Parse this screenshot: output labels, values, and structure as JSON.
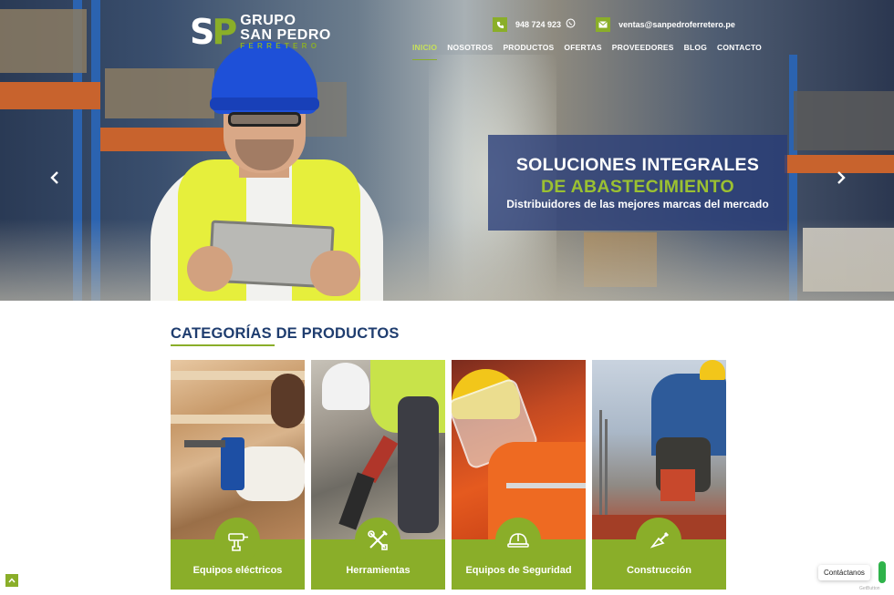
{
  "logo": {
    "mark_s": "S",
    "mark_p": "P",
    "line1": "GRUPO",
    "line2": "SAN PEDRO",
    "line3": "FERRETERO"
  },
  "contact": {
    "phone": "948 724 923",
    "email": "ventas@sanpedroferretero.pe"
  },
  "nav": {
    "items": [
      "INICIO",
      "NOSOTROS",
      "PRODUCTOS",
      "OFERTAS",
      "PROVEEDORES",
      "BLOG",
      "CONTACTO"
    ],
    "active": "INICIO"
  },
  "slider": {
    "prev_arrow": "‹",
    "next_arrow": "›"
  },
  "banner": {
    "line1": "SOLUCIONES INTEGRALES",
    "line2": "DE ABASTECIMIENTO",
    "line3": "Distribuidores de las mejores marcas del mercado"
  },
  "categories": {
    "title": "CATEGORÍAS DE PRODUCTOS",
    "items": [
      {
        "label": "Equipos eléctricos",
        "icon": "drill-icon"
      },
      {
        "label": "Herramientas",
        "icon": "tools-icon"
      },
      {
        "label": "Equipos de Seguridad",
        "icon": "helmet-icon"
      },
      {
        "label": "Construcción",
        "icon": "trowel-icon"
      }
    ]
  },
  "widgets": {
    "chat_label": "Contáctanos",
    "chat_footer": "GetButton",
    "scroll_top": "^"
  },
  "colors": {
    "brand_green": "#8aae29",
    "brand_navy": "#1f3d6f",
    "banner_bg": "#283c78"
  }
}
